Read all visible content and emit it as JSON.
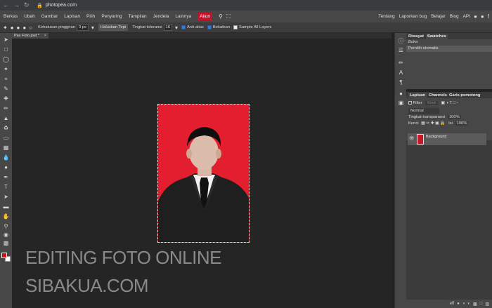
{
  "browser": {
    "url": "photopea.com",
    "nav_icons": [
      "back-icon",
      "forward-icon",
      "reload-icon"
    ],
    "lock_icon": "lock-icon"
  },
  "menu": {
    "items": [
      "Berkas",
      "Ubah",
      "Gambar",
      "Lapisan",
      "Pilih",
      "Penyaring",
      "Tampilan",
      "Jendela",
      "Lainnya"
    ],
    "active_item": "Akun",
    "right_links": [
      "Tentang",
      "Laporkan bug",
      "Belajar",
      "Blog",
      "API"
    ]
  },
  "options": {
    "feather_label": "Kehalusan pinggiran",
    "feather_value": "0 px",
    "refine_label": "Haluskan Tepi",
    "tolerance_label": "Tingkat toleransi",
    "tolerance_value": "16",
    "antialias_label": "Anti-alias",
    "contiguous_label": "Bekatkan",
    "sample_all_label": "Sample All Layers",
    "antialias_checked": true,
    "contiguous_checked": true,
    "sample_all_checked": false
  },
  "document": {
    "tab_name": "Pas Foto.psd *"
  },
  "history_panel": {
    "tabs": [
      "Riwayat",
      "Swatches"
    ],
    "items": [
      "Buka",
      "Pemilih otomatis"
    ]
  },
  "layers_panel": {
    "tabs": [
      "Lapisan",
      "Channels",
      "Garis pemotong"
    ],
    "filter_label": "Filter",
    "filter_kind": "Kind",
    "blend_mode": "Normal",
    "opacity_label": "Tingkat transparansi",
    "opacity_value": "100%",
    "lock_label": "Kunci",
    "fill_label": "Isi",
    "fill_value": "100%",
    "layers": [
      {
        "name": "Background"
      }
    ],
    "bottom_icons": [
      "link-icon",
      "fx-icon",
      "mask-icon",
      "adjustment-icon",
      "folder-icon",
      "new-layer-icon",
      "trash-icon"
    ],
    "bottom_label": "eff"
  },
  "watermark": {
    "line1": "EDITING FOTO ONLINE",
    "line2": "SIBAKUA.COM"
  },
  "colors": {
    "foreground": "#d10a16",
    "background": "#ffffff",
    "active_menu": "#c8112a",
    "photo_bg": "#e21e2f"
  }
}
